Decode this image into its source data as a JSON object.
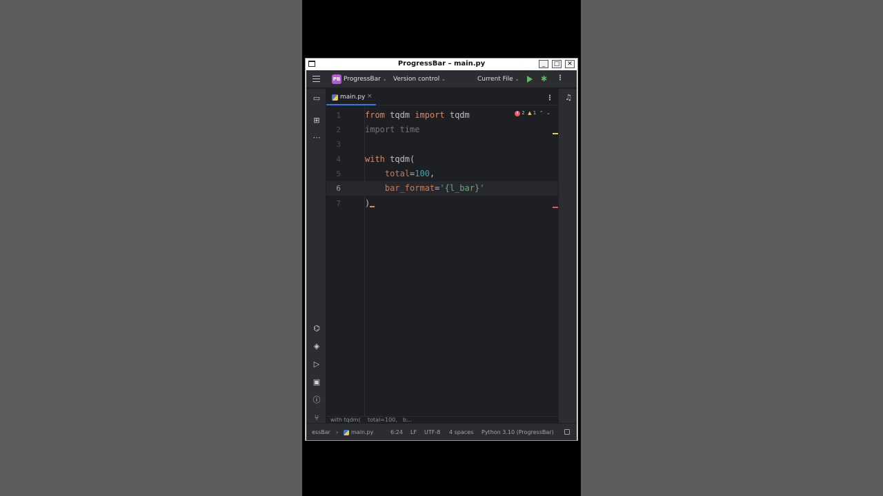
{
  "window": {
    "title": "ProgressBar – main.py",
    "minimize": "_",
    "maximize": "□",
    "close": "✕"
  },
  "toolbar": {
    "project_badge": "PB",
    "project_name": "ProgressBar",
    "vcs": "Version control",
    "run_config": "Current File",
    "chevron": "⌄"
  },
  "sidebar": {
    "top_icons": [
      "folder-icon",
      "structure-icon",
      "more-icon"
    ],
    "bottom_icons": [
      "python-console-icon",
      "python-packages-icon",
      "services-icon",
      "terminal-icon",
      "problems-icon",
      "git-icon"
    ]
  },
  "tab": {
    "label": "main.py",
    "close": "×"
  },
  "inspections": {
    "errors": "2",
    "warnings": "1"
  },
  "code_lines": [
    {
      "n": "1",
      "text": "from tqdm import tqdm"
    },
    {
      "n": "2",
      "text": "import time"
    },
    {
      "n": "3",
      "text": ""
    },
    {
      "n": "4",
      "text": "with tqdm("
    },
    {
      "n": "5",
      "text": "    total=100,"
    },
    {
      "n": "6",
      "text": "    bar_format='{l_bar}'"
    },
    {
      "n": "7",
      "text": ")"
    }
  ],
  "current_line": "6",
  "breadcrumb": {
    "part1": "with tqdm(",
    "part2": "total=100,",
    "part3": "b..."
  },
  "status": {
    "project": "essBar",
    "separator": "›",
    "file": "main.py",
    "position": "6:24",
    "line_sep": "LF",
    "encoding": "UTF-8",
    "indent": "4 spaces",
    "interpreter": "Python 3.10 (ProgressBar)"
  },
  "colors": {
    "keyword": "#cf8e6d",
    "number": "#2aacb8",
    "string": "#6aab73",
    "accent": "#3574f0",
    "run": "#5fb865",
    "error": "#e55765",
    "warning": "#f2c55c"
  }
}
